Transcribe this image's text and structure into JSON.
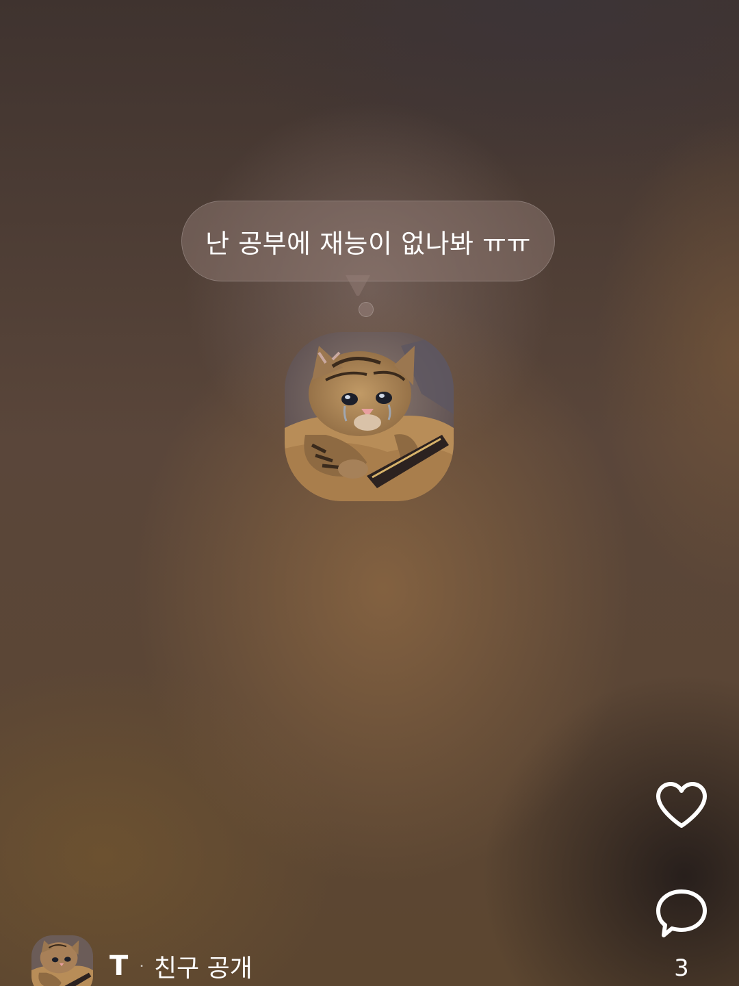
{
  "status": {
    "text": "난 공부에 재능이 없나봐 ㅠㅠ"
  },
  "profile": {
    "image_icon": "crying-cat-image",
    "avatar_icon": "crying-cat-avatar"
  },
  "author": {
    "name": "T",
    "separator": "·",
    "visibility": "친구 공개"
  },
  "actions": {
    "like_icon": "heart-icon",
    "comment_icon": "comment-bubble-icon",
    "comment_count": "3"
  },
  "colors": {
    "text": "#ffffff",
    "bubble_bg": "#96807a",
    "background": "#4a3b32"
  }
}
